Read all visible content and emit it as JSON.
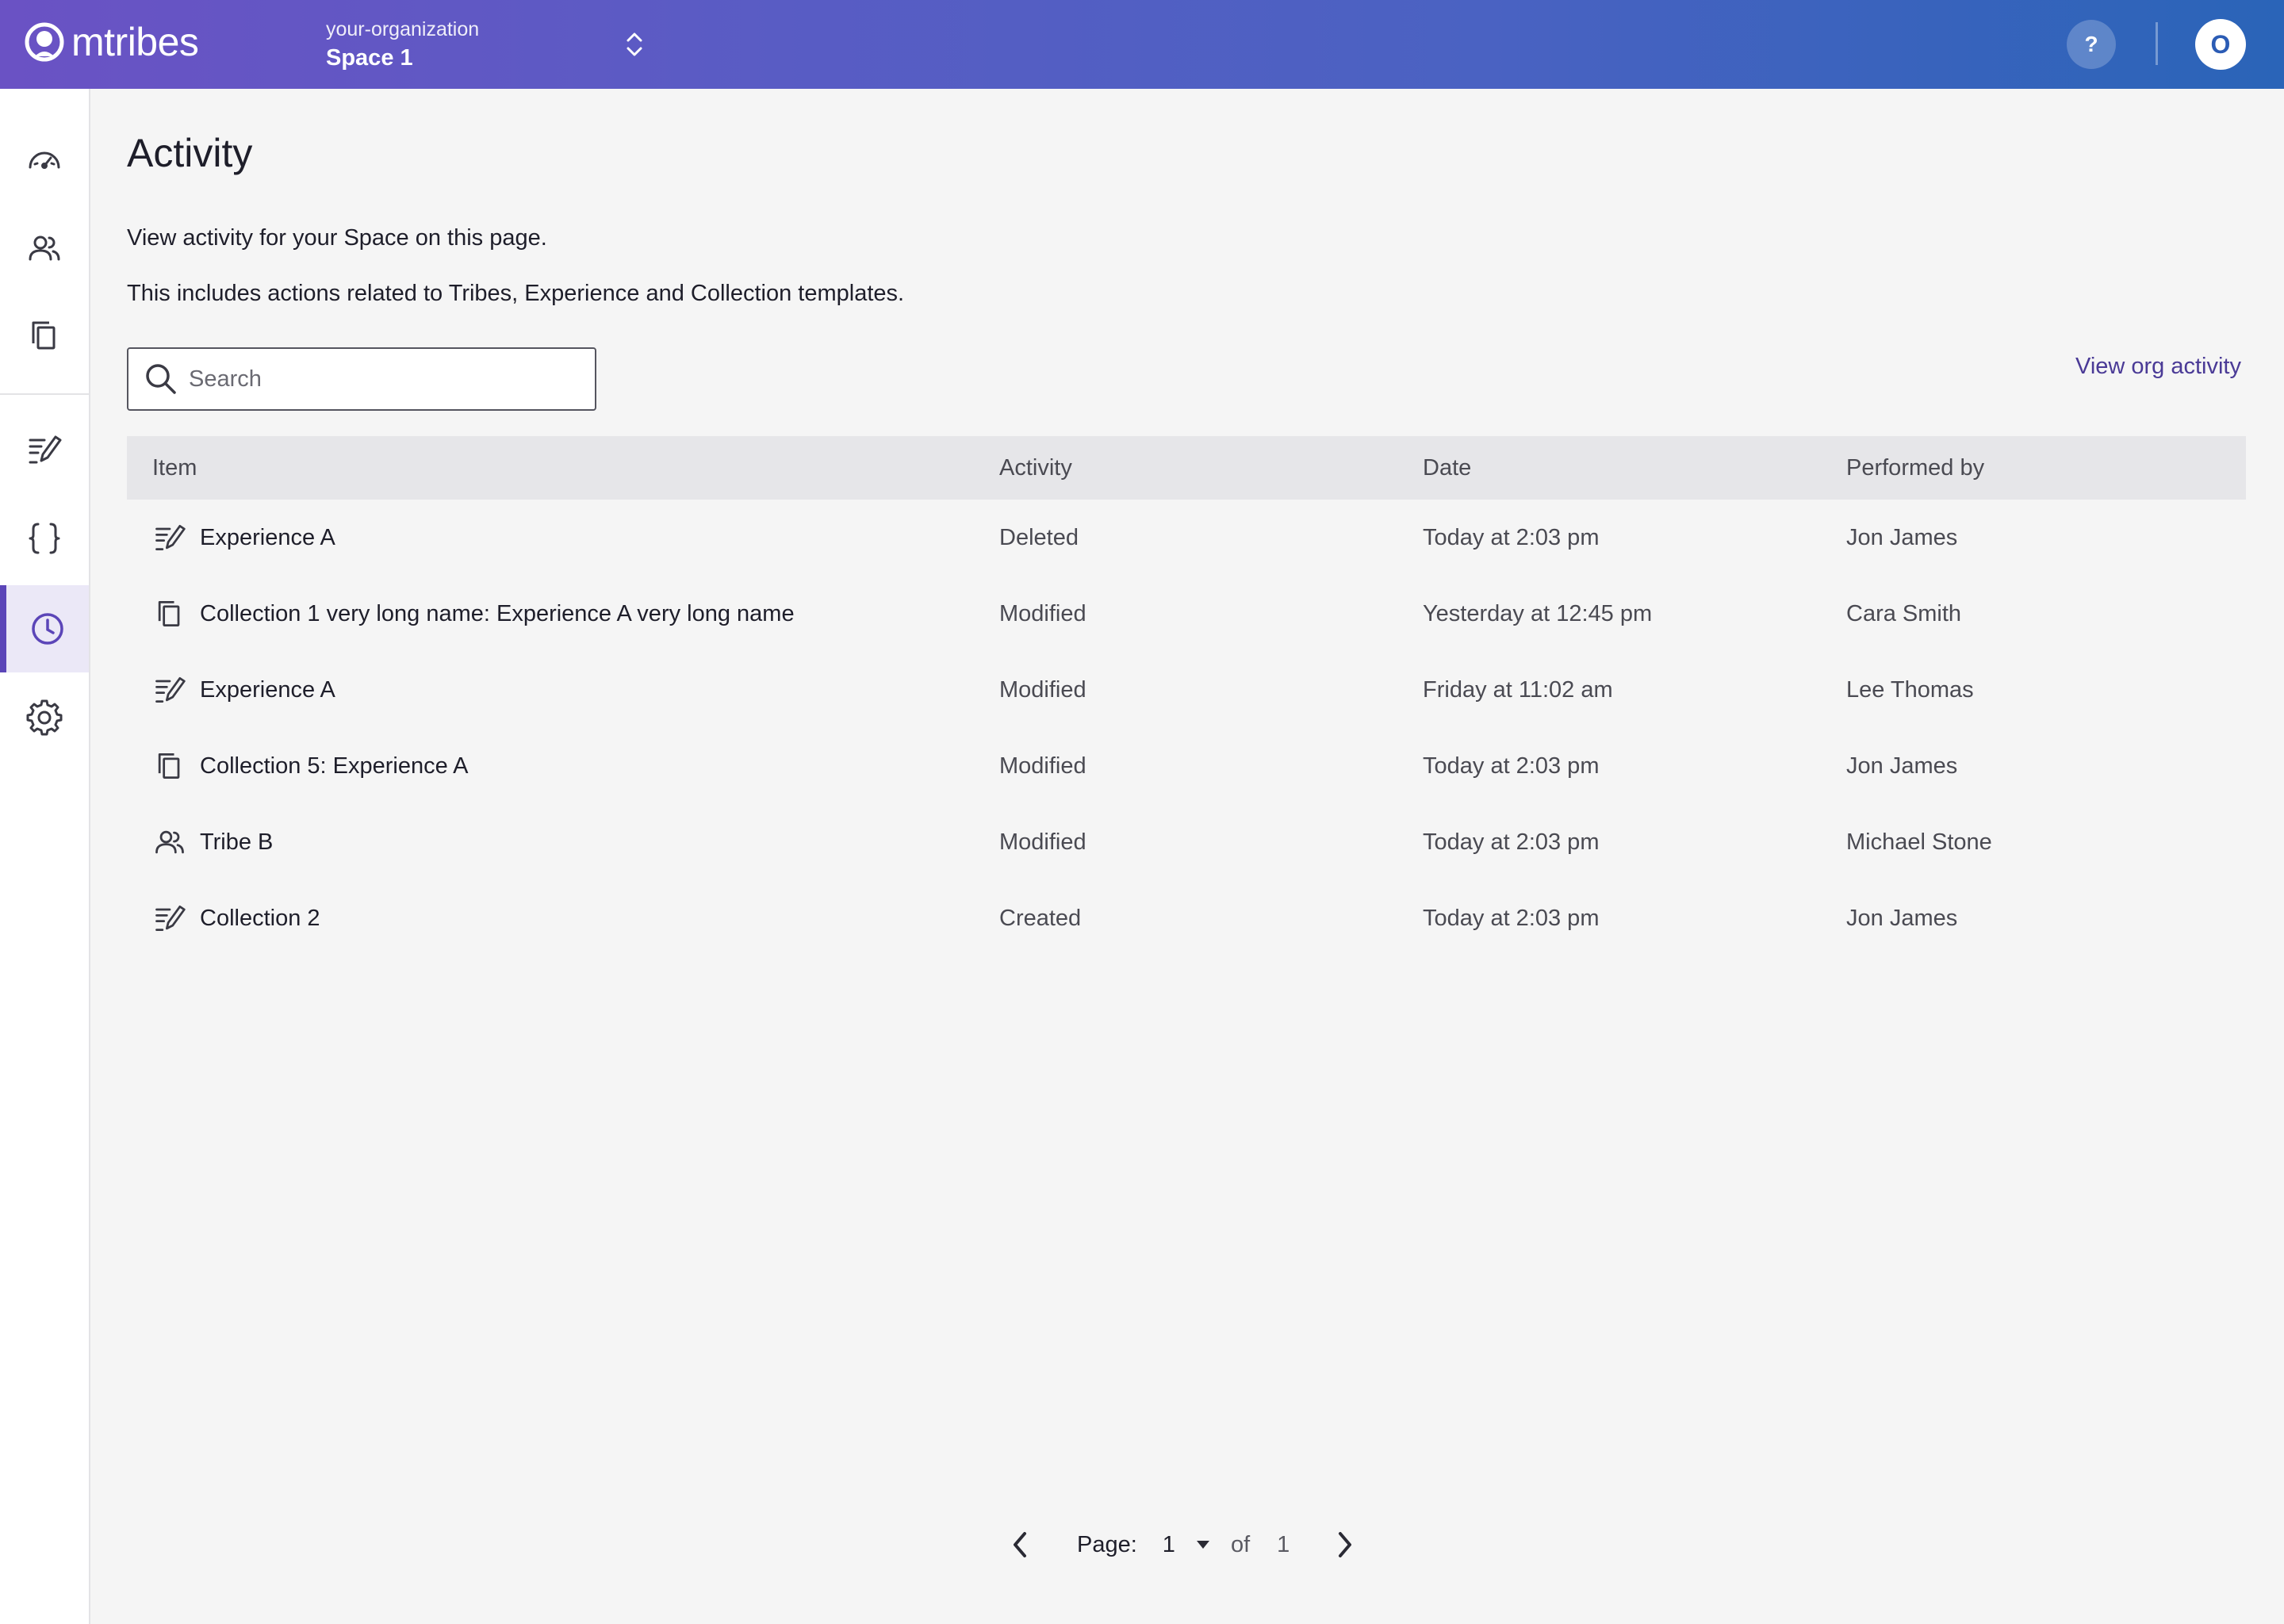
{
  "app": {
    "logo_text": "mtribes"
  },
  "header": {
    "org_name": "your-organization",
    "space_name": "Space 1",
    "help_label": "?",
    "avatar_initial": "O"
  },
  "sidebar": {
    "items": [
      {
        "icon": "dashboard-icon"
      },
      {
        "icon": "users-icon"
      },
      {
        "icon": "copy-icon"
      },
      {
        "icon": "edit-list-icon"
      },
      {
        "icon": "braces-icon"
      },
      {
        "icon": "clock-icon",
        "active": true
      },
      {
        "icon": "gear-icon"
      }
    ]
  },
  "page": {
    "title": "Activity",
    "description_1": "View activity for your Space on this page.",
    "description_2": "This includes actions related to Tribes, Experience and Collection templates.",
    "org_link": "View org activity"
  },
  "search": {
    "placeholder": "Search",
    "value": ""
  },
  "table": {
    "headers": [
      "Item",
      "Activity",
      "Date",
      "Performed by"
    ],
    "rows": [
      {
        "icon": "experience-icon",
        "item": "Experience A",
        "activity": "Deleted",
        "date": "Today at 2:03 pm",
        "by": "Jon James"
      },
      {
        "icon": "collection-icon",
        "item": "Collection 1 very long name: Experience A very long name",
        "activity": "Modified",
        "date": "Yesterday at 12:45 pm",
        "by": "Cara Smith"
      },
      {
        "icon": "experience-icon",
        "item": "Experience A",
        "activity": "Modified",
        "date": "Friday at 11:02 am",
        "by": "Lee Thomas"
      },
      {
        "icon": "collection-icon",
        "item": "Collection 5: Experience A",
        "activity": "Modified",
        "date": "Today at 2:03 pm",
        "by": "Jon James"
      },
      {
        "icon": "tribe-icon",
        "item": "Tribe B",
        "activity": "Modified",
        "date": "Today at 2:03 pm",
        "by": "Michael Stone"
      },
      {
        "icon": "experience-icon",
        "item": "Collection 2",
        "activity": "Created",
        "date": "Today at 2:03 pm",
        "by": "Jon James"
      }
    ]
  },
  "pagination": {
    "label": "Page:",
    "current": "1",
    "of_label": "of",
    "total": "1"
  },
  "colors": {
    "accent": "#5b45b8",
    "link": "#4a3a96"
  }
}
